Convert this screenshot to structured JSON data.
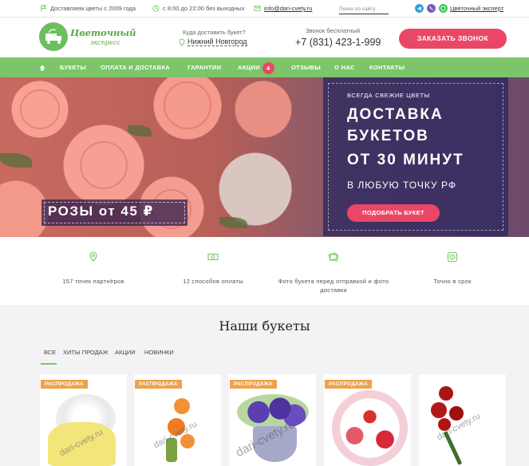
{
  "topbar": {
    "since": "Доставляем цветы с 2009 года",
    "hours": "с 8:00 до 22:00 без выходных",
    "email": "info@dari-cvety.ru",
    "search_placeholder": "Поиск по сайту",
    "social_label": "Цветочный эксперт"
  },
  "header": {
    "logo_line1": "Цветочный",
    "logo_line2": "экспресс",
    "deliver_question": "Куда доставить букет?",
    "city": "Нижний Новгород",
    "free_call": "Звонок бесплатный",
    "phone": "+7 (831) 423-1-999",
    "order_call": "ЗАКАЗАТЬ ЗВОНОК"
  },
  "nav": {
    "home_icon": "home-icon",
    "items": [
      "БУКЕТЫ",
      "ОПЛАТА И ДОСТАВКА",
      "ГАРАНТИИ",
      "АКЦИИ",
      "ОТЗЫВЫ",
      "О НАС",
      "КОНТАКТЫ"
    ],
    "promo_count": "4"
  },
  "hero": {
    "promo": "РОЗЫ от 45 ₽",
    "kicker": "ВСЕГДА СВЕЖИЕ ЦВЕТЫ",
    "line1": "ДОСТАВКА",
    "line2": "БУКЕТОВ",
    "line3": "ОТ 30 МИНУТ",
    "sub": "В ЛЮБУЮ ТОЧКУ РФ",
    "button": "ПОДОБРАТЬ БУКЕТ"
  },
  "features": [
    {
      "icon": "map-pin-icon",
      "label": "157 точек партнёров"
    },
    {
      "icon": "cash-icon",
      "label": "12 способов оплаты"
    },
    {
      "icon": "photo-icon",
      "label": "Фото букета перед отправкой и фото доставки"
    },
    {
      "icon": "clock-icon",
      "label": "Точно в срок"
    }
  ],
  "bouquets": {
    "title": "Наши букеты",
    "filters": [
      "ВСЕ",
      "ХИТЫ ПРОДАЖ",
      "АКЦИИ",
      "НОВИНКИ"
    ],
    "sale_label": "РАСПРОДАЖА",
    "watermark": "dari-cvety.ru"
  },
  "colors": {
    "accent_pink": "#ea4766",
    "nav_green": "#7cc56a",
    "panel_purple": "#302a60",
    "sale_orange": "#f0a14a"
  }
}
